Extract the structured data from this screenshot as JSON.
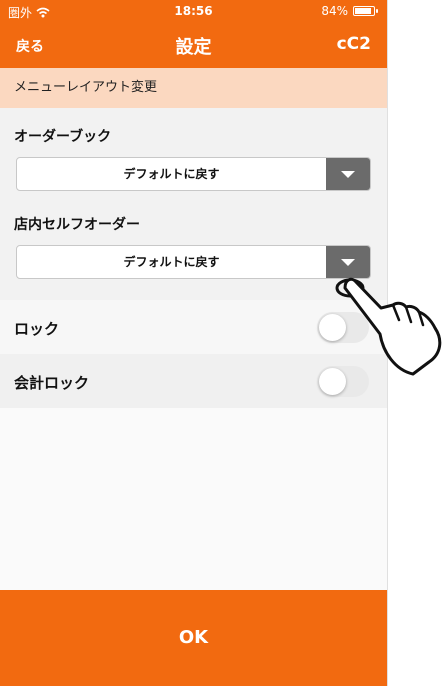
{
  "status_bar": {
    "carrier": "圏外",
    "time": "18:56",
    "battery": "84%"
  },
  "nav": {
    "back_label": "戻る",
    "title": "設定",
    "code": "cC2"
  },
  "section_header": "メニューレイアウト変更",
  "order_book": {
    "label": "オーダーブック",
    "value": "デフォルトに戻す"
  },
  "self_order": {
    "label": "店内セルフオーダー",
    "value": "デフォルトに戻す"
  },
  "lock": {
    "label": "ロック",
    "on": false
  },
  "accounting_lock": {
    "label": "会計ロック",
    "on": false
  },
  "ok_label": "OK",
  "colors": {
    "accent": "#f26a10",
    "section_bg": "#fbd8c0",
    "dropdown_button": "#6b6b6b"
  },
  "icons": [
    "wifi-icon",
    "battery-icon",
    "chevron-down-icon",
    "tap-hand-icon"
  ]
}
